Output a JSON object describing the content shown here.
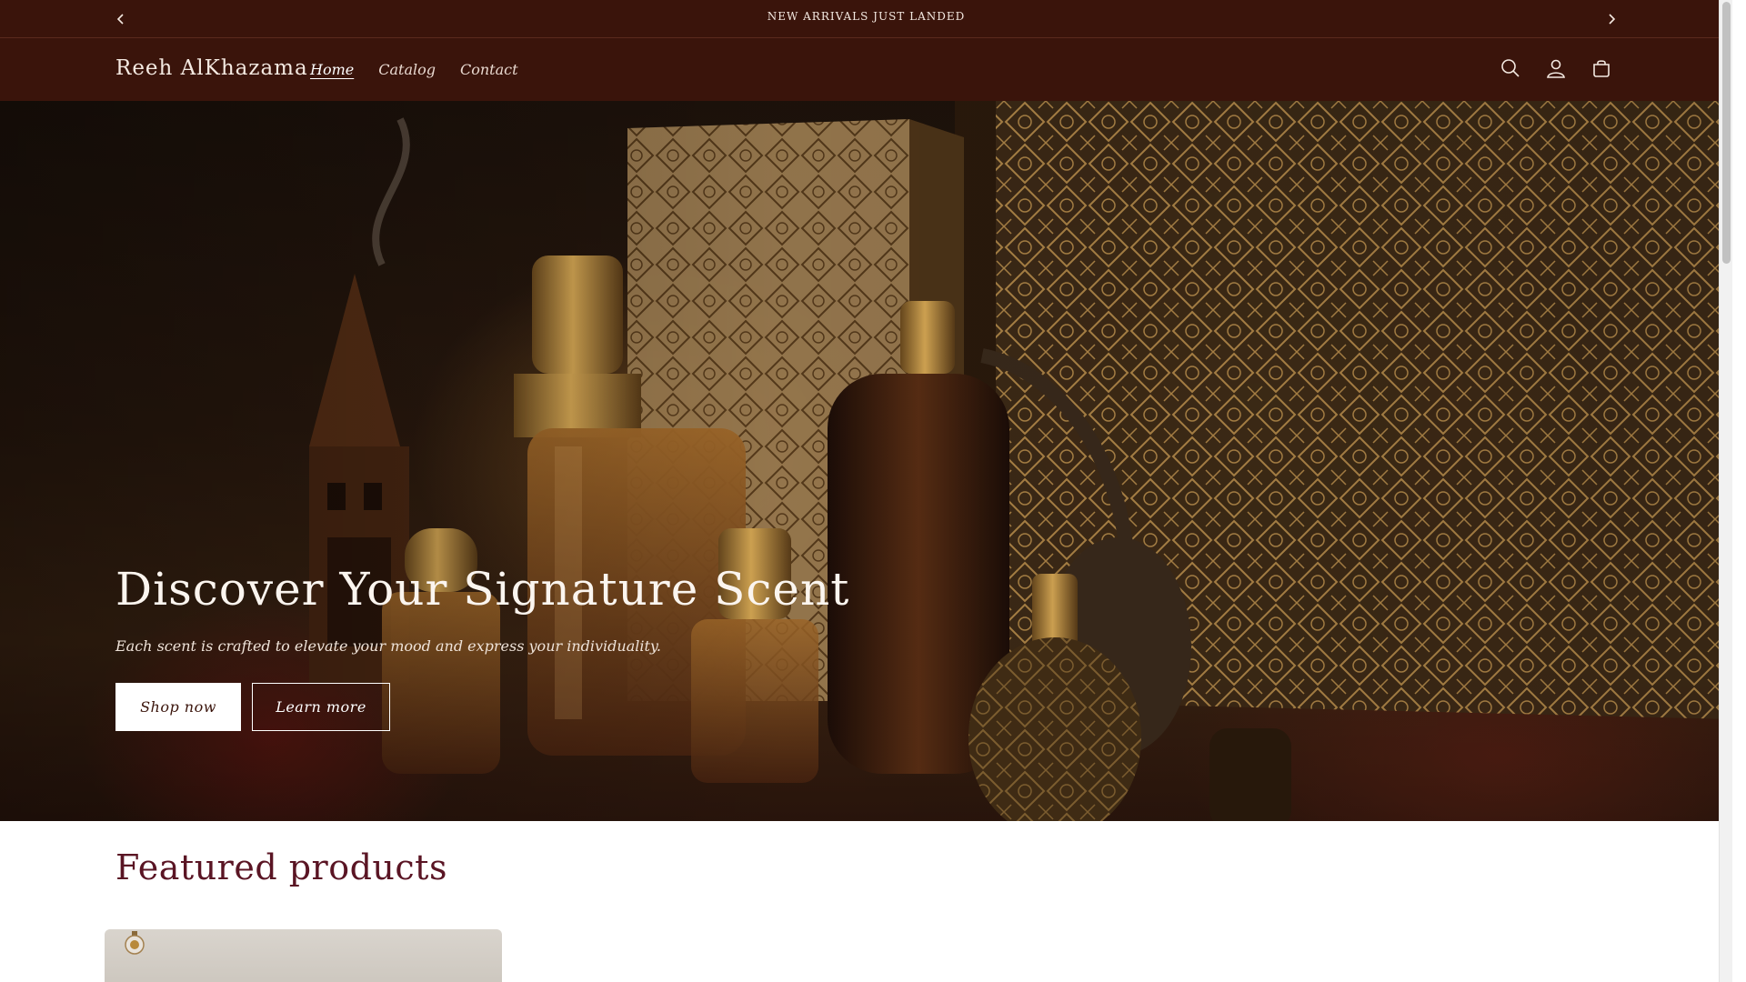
{
  "announcement": {
    "text": "NEW ARRIVALS JUST LANDED",
    "prev_icon": "chevron-left-icon",
    "next_icon": "chevron-right-icon"
  },
  "header": {
    "brand": "Reeh AlKhazama",
    "nav": [
      {
        "label": "Home",
        "active": true
      },
      {
        "label": "Catalog",
        "active": false
      },
      {
        "label": "Contact",
        "active": false
      }
    ],
    "icons": [
      "search-icon",
      "account-icon",
      "cart-icon"
    ]
  },
  "hero": {
    "heading": "Discover Your Signature Scent",
    "subheading": "Each scent is crafted to elevate your mood and express your individuality.",
    "primary_button": "Shop now",
    "secondary_button": "Learn more"
  },
  "featured": {
    "title": "Featured products"
  },
  "colors": {
    "header_bg": "#3a140b",
    "accent": "#5a1524",
    "gold": "#b8893a"
  }
}
